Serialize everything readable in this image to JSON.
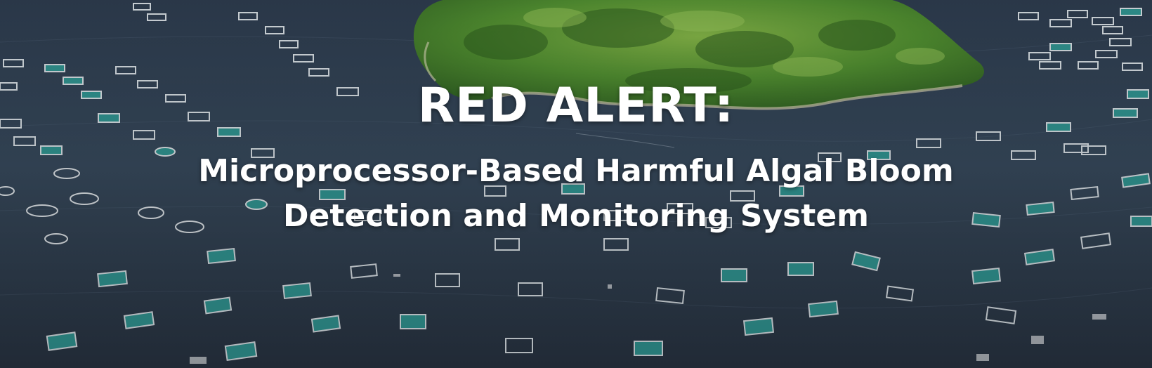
{
  "banner": {
    "headline": "RED ALERT:",
    "subtitle_line1": "Microprocessor-Based Harmful Algal Bloom",
    "subtitle_line2": "Detection and Monitoring System"
  },
  "photo": {
    "subject": "aerial-view-fish-cages-around-island",
    "colors": {
      "water": "#34455a",
      "water_dark": "#243041",
      "island_green": "#3f7a2a",
      "island_light": "#79a944",
      "cage_fill": "#2f8f8c",
      "cage_frame": "#cfd6db"
    }
  }
}
